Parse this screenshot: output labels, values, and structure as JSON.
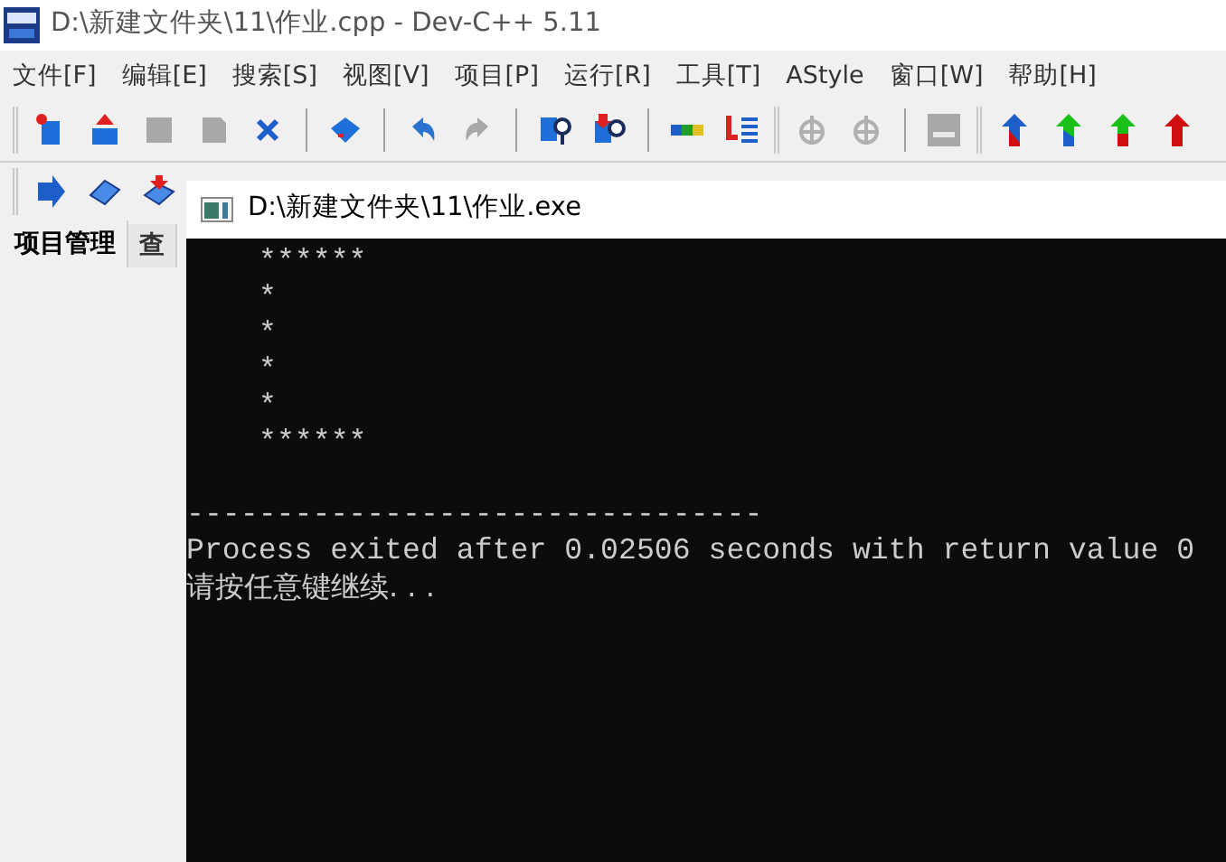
{
  "window": {
    "title": "D:\\新建文件夹\\11\\作业.cpp - Dev-C++ 5.11"
  },
  "menu": [
    "文件[F]",
    "编辑[E]",
    "搜索[S]",
    "视图[V]",
    "项目[P]",
    "运行[R]",
    "工具[T]",
    "AStyle",
    "窗口[W]",
    "帮助[H]"
  ],
  "left_tabs": [
    {
      "label": "项目管理",
      "selected": true
    },
    {
      "label": "查",
      "selected": false
    }
  ],
  "console": {
    "title": "D:\\新建文件夹\\11\\作业.exe",
    "output": [
      "******",
      "*",
      "*",
      "*",
      "*",
      "******"
    ],
    "separator": "--------------------------------",
    "exit_message": "Process exited after 0.02506 seconds with return value 0",
    "prompt": "请按任意键继续. . ."
  }
}
